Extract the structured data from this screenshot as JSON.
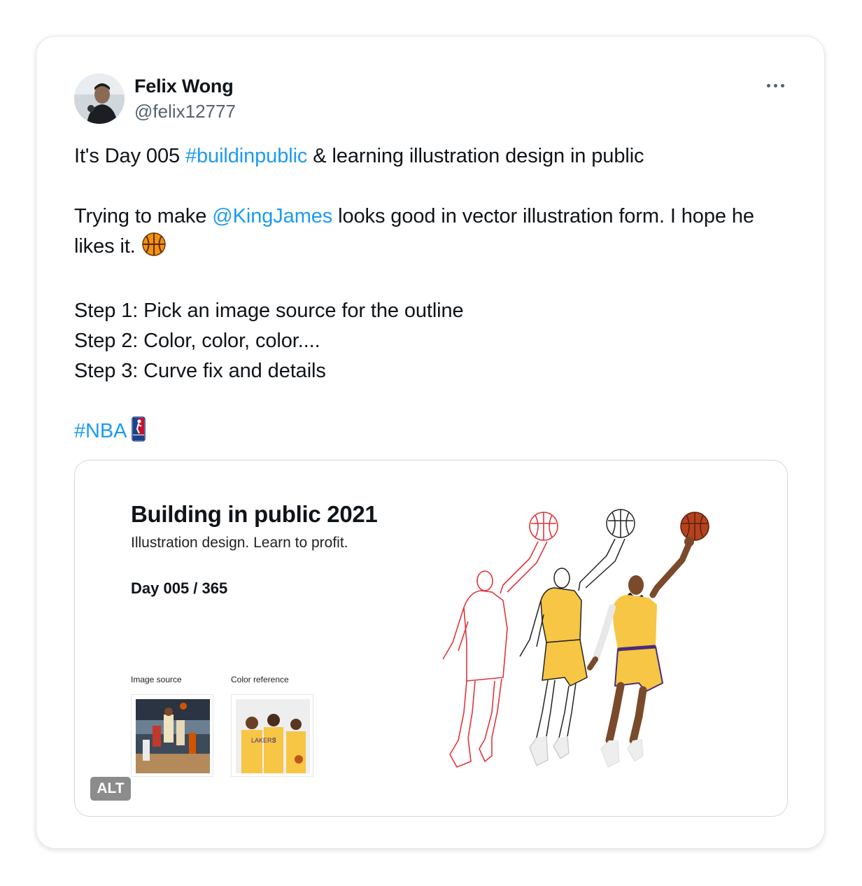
{
  "author": {
    "name": "Felix Wong",
    "handle": "@felix12777"
  },
  "tweet": {
    "line1_pre": "It's Day 005 ",
    "hashtag1": "#buildinpublic",
    "line1_post": " & learning illustration design in public",
    "line2_pre": "Trying to make ",
    "mention": "@KingJames",
    "line2_post": " looks good in vector illustration form. I hope he likes it. ",
    "steps": "Step 1: Pick an image source for the outline\nStep 2: Color, color, color....\nStep 3: Curve fix and details",
    "hashtag2": "#NBA",
    "emoji1": "basketball-emoji",
    "emoji2": "nba-logo-emoji"
  },
  "media": {
    "title": "Building in public 2021",
    "subtitle": "Illustration design. Learn to profit.",
    "day": "Day 005 / 365",
    "caption_source": "Image source",
    "caption_color": "Color reference",
    "alt_badge": "ALT"
  },
  "colors": {
    "link": "#1d9bf0",
    "lakers_gold": "#f6c644",
    "lakers_purple": "#4a2c7a",
    "outline_red": "#e2343c"
  }
}
